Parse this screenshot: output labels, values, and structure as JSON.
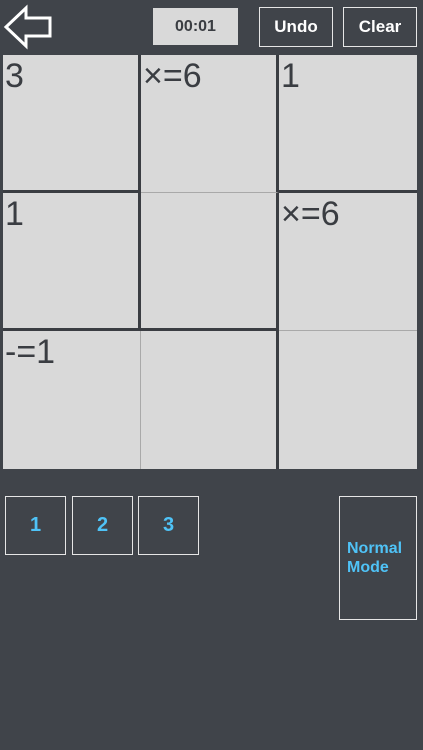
{
  "header": {
    "back_icon": "arrow-left-icon",
    "timer": "00:01",
    "undo_label": "Undo",
    "clear_label": "Clear"
  },
  "board": {
    "cells": [
      {
        "clue": "3"
      },
      {
        "clue": "×=6"
      },
      {
        "clue": "1"
      },
      {
        "clue": "1"
      },
      {
        "clue": ""
      },
      {
        "clue": "×=6"
      },
      {
        "clue": "-=1"
      },
      {
        "clue": ""
      },
      {
        "clue": ""
      }
    ]
  },
  "numbers": [
    "1",
    "2",
    "3"
  ],
  "mode_label": "Normal\nMode",
  "colors": {
    "background": "#40444a",
    "cell": "#d9d9d9",
    "accent": "#4fc3f7"
  }
}
